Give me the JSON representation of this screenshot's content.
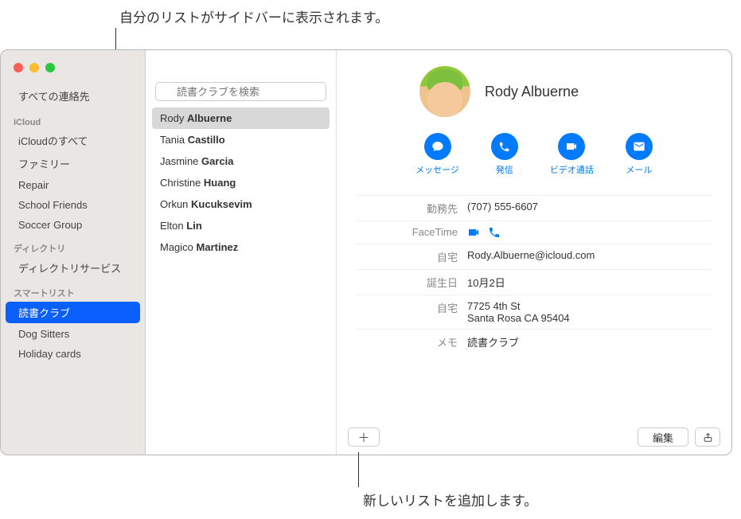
{
  "callouts": {
    "top": "自分のリストがサイドバーに表示されます。",
    "bottom": "新しいリストを追加します。"
  },
  "sidebar": {
    "allContacts": "すべての連絡先",
    "sections": [
      {
        "heading": "iCloud",
        "items": [
          "iCloudのすべて",
          "ファミリー",
          "Repair",
          "School Friends",
          "Soccer Group"
        ]
      },
      {
        "heading": "ディレクトリ",
        "items": [
          "ディレクトリサービス"
        ]
      },
      {
        "heading": "スマートリスト",
        "items": [
          "読書クラブ",
          "Dog Sitters",
          "Holiday cards"
        ],
        "selectedIndex": 0
      }
    ]
  },
  "search": {
    "placeholder": "読書クラブを検索"
  },
  "contacts": [
    {
      "first": "Rody",
      "last": "Albuerne",
      "selected": true
    },
    {
      "first": "Tania",
      "last": "Castillo"
    },
    {
      "first": "Jasmine",
      "last": "Garcia"
    },
    {
      "first": "Christine",
      "last": "Huang"
    },
    {
      "first": "Orkun",
      "last": "Kucuksevim"
    },
    {
      "first": "Elton",
      "last": "Lin"
    },
    {
      "first": "Magico",
      "last": "Martinez"
    }
  ],
  "detail": {
    "name": "Rody Albuerne",
    "actions": {
      "message": "メッセージ",
      "call": "発信",
      "video": "ビデオ通話",
      "mail": "メール"
    },
    "fields": {
      "workLabel": "勤務先",
      "workValue": "(707) 555-6607",
      "facetimeLabel": "FaceTime",
      "homeEmailLabel": "自宅",
      "homeEmailValue": "Rody.Albuerne@icloud.com",
      "birthdayLabel": "誕生日",
      "birthdayValue": "10月2日",
      "homeAddrLabel": "自宅",
      "homeAddrLine1": "7725 4th St",
      "homeAddrLine2": "Santa Rosa CA 95404",
      "memoLabel": "メモ",
      "memoValue": "読書クラブ"
    },
    "editLabel": "編集"
  }
}
